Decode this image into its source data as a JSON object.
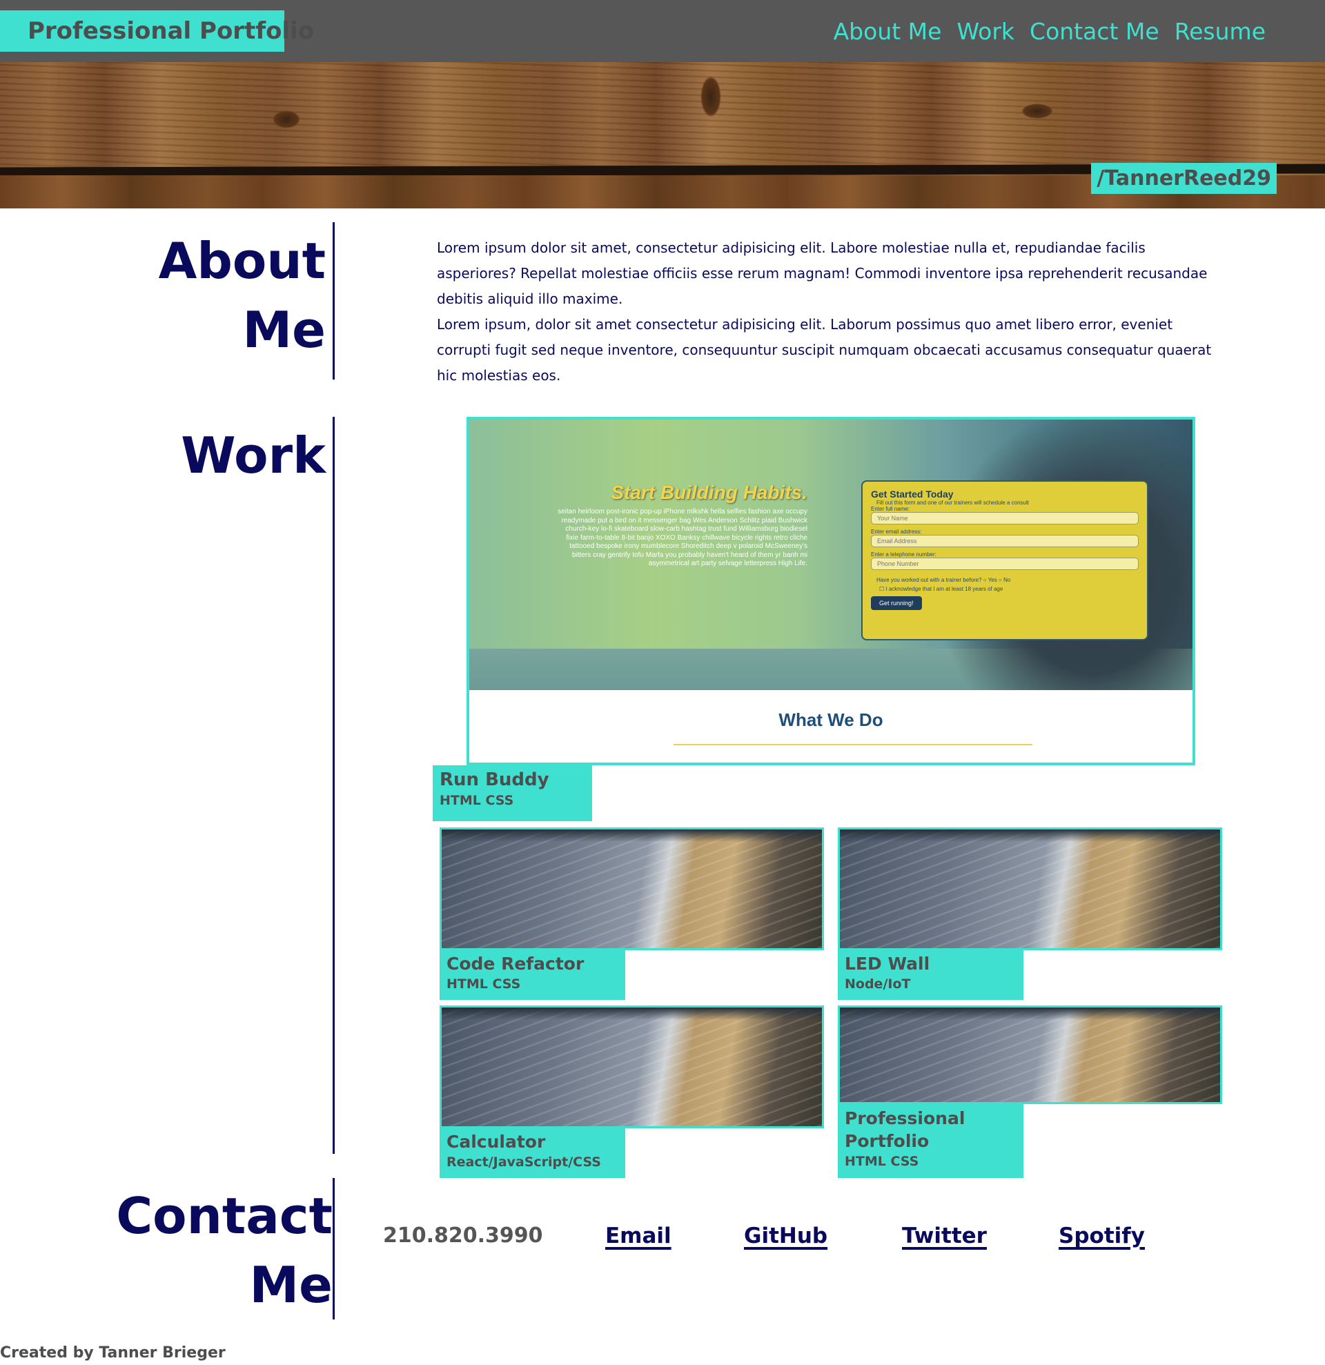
{
  "header": {
    "brand": "Professional Portfolio",
    "nav": [
      "About Me",
      "Work",
      "Contact Me",
      "Resume"
    ],
    "handle": "/TannerReed29"
  },
  "about": {
    "title_line1": "About",
    "title_line2": "Me",
    "paragraph1": "Lorem ipsum dolor sit amet, consectetur adipisicing elit. Labore molestiae nulla et, repudiandae facilis asperiores? Repellat molestiae officiis esse rerum magnam! Commodi inventore ipsa reprehenderit recusandae debitis aliquid illo maxime.",
    "paragraph2": "Lorem ipsum, dolor sit amet consectetur adipisicing elit. Laborum possimus quo amet libero error, eveniet corrupti fugit sed neque inventore, consequuntur suscipit numquam obcaecati accusamus consequatur quaerat hic molestias eos."
  },
  "work": {
    "title": "Work",
    "featured": {
      "name": "Run Buddy",
      "tech": "HTML CSS",
      "screenshot": {
        "headline": "Start Building Habits.",
        "copy": "seitan heirloom post-ironic pop-up iPhone mlkshk hella selfies fashion axe occupy readymade put a bird on it messenger bag Wes Anderson Schlitz plaid Bushwick church-key lo-fi skateboard slow-carb hashtag trust fund Williamsburg biodiesel fixie farm-to-table 8-bit banjo XOXO Banksy chillwave bicycle rights retro cliche tattooed bespoke irony mumblecore Shoreditch deep v polaroid McSweeney's bitters cray gentrify tofu Marfa you probably haven't heard of them yr banh mi asymmetrical art party selvage letterpress High Life.",
        "form_title": "Get Started Today",
        "form_subtitle": "Fill out this form and one of our trainers will schedule a consult",
        "label_name": "Enter full name:",
        "placeholder_name": "Your Name",
        "label_email": "Enter email address:",
        "placeholder_email": "Email Address",
        "label_phone": "Enter a telephone number:",
        "placeholder_phone": "Phone Number",
        "question": "Have you worked out with a trainer before?",
        "option_yes": "Yes",
        "option_no": "No",
        "acknowledge": "I acknowledge that I am at least 18 years of age",
        "button": "Get running!",
        "section_title": "What We Do"
      }
    },
    "projects": [
      {
        "name": "Code Refactor",
        "tech": "HTML CSS"
      },
      {
        "name": "LED Wall",
        "tech": "Node/IoT"
      },
      {
        "name": "Calculator",
        "tech": "React/JavaScript/CSS"
      },
      {
        "name": "Professional Portfolio",
        "tech": "HTML CSS"
      }
    ]
  },
  "contact": {
    "title_line1": "Contact",
    "title_line2": "Me",
    "phone": "210.820.3990",
    "links": [
      "Email",
      "GitHub",
      "Twitter",
      "Spotify"
    ]
  },
  "footer": {
    "credit": "Created by Tanner Brieger"
  },
  "colors": {
    "accent": "#40e0d0",
    "navy": "#0a0a5c",
    "bar": "#575757",
    "gray_text": "#4d4d4d"
  }
}
